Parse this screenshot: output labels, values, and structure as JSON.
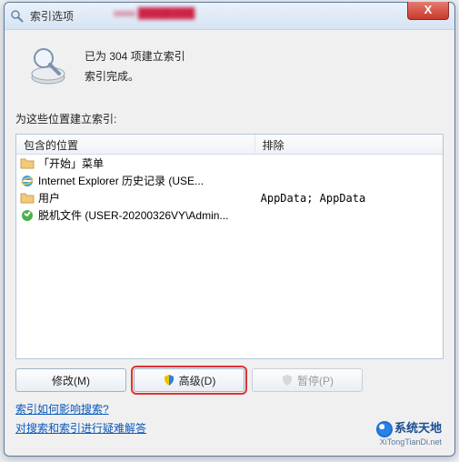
{
  "window": {
    "title": "索引选项",
    "close": "X"
  },
  "banner": {
    "line1": "已为 304 项建立索引",
    "line2": "索引完成。"
  },
  "section_label": "为这些位置建立索引:",
  "columns": {
    "included": "包含的位置",
    "excluded": "排除"
  },
  "rows": [
    {
      "icon": "folder-icon",
      "label": "「开始」菜单",
      "exclude": ""
    },
    {
      "icon": "ie-icon",
      "label": "Internet Explorer 历史记录 (USE...",
      "exclude": ""
    },
    {
      "icon": "folder-icon",
      "label": "用户",
      "exclude": "AppData; AppData"
    },
    {
      "icon": "offline-icon",
      "label": "脱机文件 (USER-20200326VY\\Admin...",
      "exclude": ""
    }
  ],
  "buttons": {
    "modify": "修改(M)",
    "advanced": "高级(D)",
    "pause": "暂停(P)"
  },
  "links": {
    "l1": "索引如何影响搜索?",
    "l2": "对搜索和索引进行疑难解答"
  },
  "brand": {
    "main": "系统天地",
    "sub": "XiTongTianDi.net"
  }
}
